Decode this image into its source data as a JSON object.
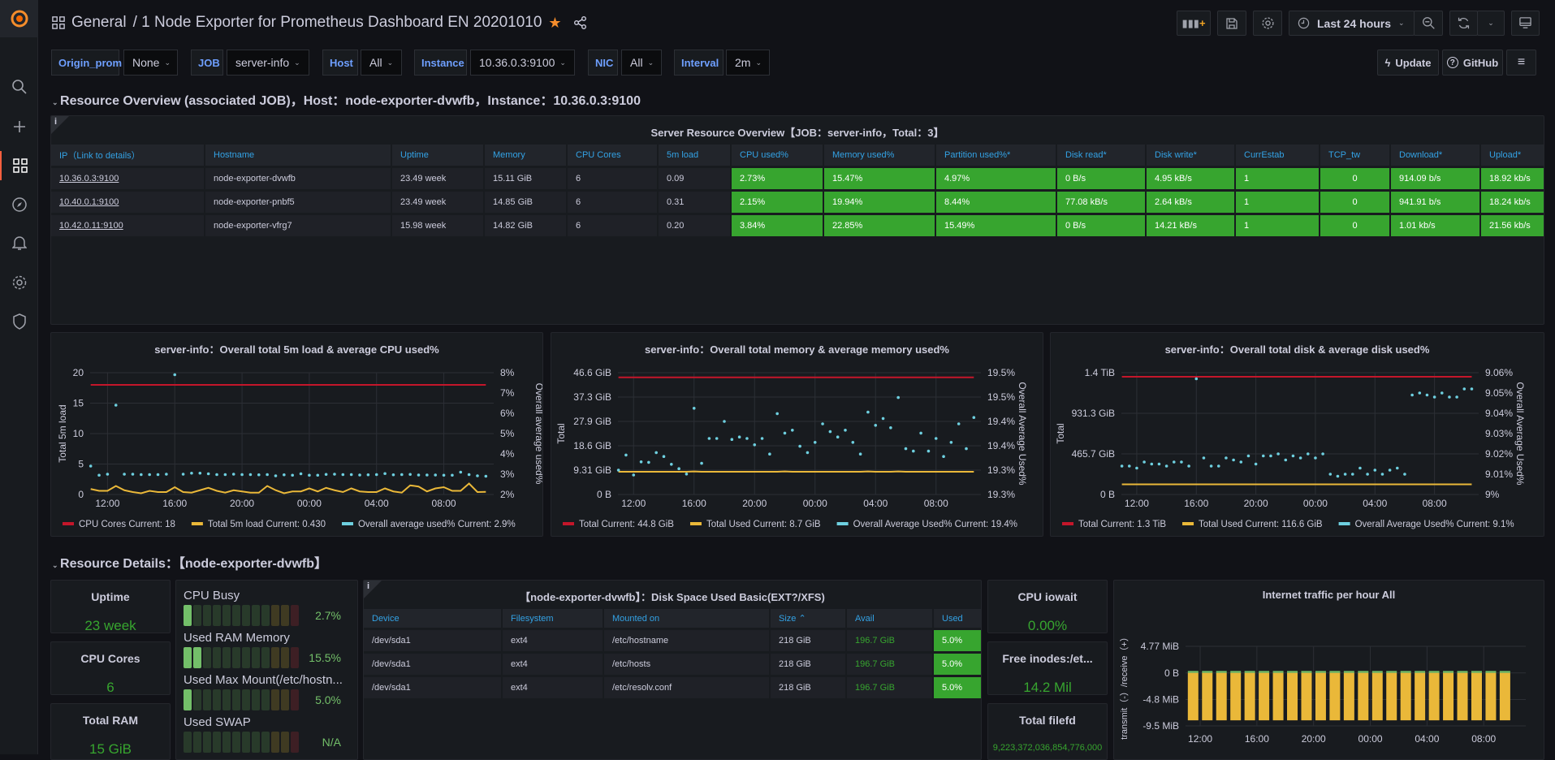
{
  "header": {
    "breadcrumb_folder": "General",
    "title": "/ 1 Node Exporter for Prometheus Dashboard EN 20201010",
    "time_range": "Last 24 hours",
    "update_label": "Update",
    "github_label": "GitHub"
  },
  "sidebar": {
    "items": [
      "grafana-logo",
      "search",
      "create",
      "dashboards",
      "explore",
      "alerting",
      "configuration",
      "server-admin"
    ]
  },
  "variables": [
    {
      "label": "Origin_prom",
      "value": "None"
    },
    {
      "label": "JOB",
      "value": "server-info"
    },
    {
      "label": "Host",
      "value": "All"
    },
    {
      "label": "Instance",
      "value": "10.36.0.3:9100"
    },
    {
      "label": "NIC",
      "value": "All"
    },
    {
      "label": "Interval",
      "value": "2m"
    }
  ],
  "rows": {
    "overview": "Resource Overview (associated JOB)，Host：node-exporter-dvwfb，Instance：10.36.0.3:9100",
    "details": "Resource Details：【node-exporter-dvwfb】"
  },
  "server_table": {
    "title": "Server Resource Overview【JOB：server-info，Total：3】",
    "columns": [
      "IP（Link to details）",
      "Hostname",
      "Uptime",
      "Memory",
      "CPU Cores",
      "5m load",
      "CPU used%",
      "Memory used%",
      "Partition used%*",
      "Disk read*",
      "Disk write*",
      "CurrEstab",
      "TCP_tw",
      "Download*",
      "Upload*"
    ],
    "rows": [
      [
        "10.36.0.3:9100",
        "node-exporter-dvwfb",
        "23.49 week",
        "15.11 GiB",
        "6",
        "0.09",
        "2.73%",
        "15.47%",
        "4.97%",
        "0 B/s",
        "4.95 kB/s",
        "1",
        "0",
        "914.09 b/s",
        "18.92 kb/s"
      ],
      [
        "10.40.0.1:9100",
        "node-exporter-pnbf5",
        "23.49 week",
        "14.85 GiB",
        "6",
        "0.31",
        "2.15%",
        "19.94%",
        "8.44%",
        "77.08 kB/s",
        "2.64 kB/s",
        "1",
        "0",
        "941.91 b/s",
        "18.24 kb/s"
      ],
      [
        "10.42.0.11:9100",
        "node-exporter-vfrg7",
        "15.98 week",
        "14.82 GiB",
        "6",
        "0.20",
        "3.84%",
        "22.85%",
        "15.49%",
        "0 B/s",
        "14.21 kB/s",
        "1",
        "0",
        "1.01 kb/s",
        "21.56 kb/s"
      ]
    ]
  },
  "colors": {
    "red": "#C4162A",
    "yellow": "#EAB839",
    "cyan": "#6ED0E0",
    "green": "#37A52F",
    "green_bar": "#73BF69"
  },
  "chart_data": [
    {
      "type": "line",
      "title": "server-info：Overall total 5m load & average CPU used%",
      "ylabel": "Total 5m load",
      "ylabel_right": "Overall average used%",
      "ylim": [
        0,
        20
      ],
      "yticks": [
        "0",
        "5",
        "10",
        "15",
        "20"
      ],
      "ylim_right": [
        2,
        8
      ],
      "yticks_right": [
        "2%",
        "3%",
        "4%",
        "5%",
        "6%",
        "7%",
        "8%"
      ],
      "xticks": [
        "12:00",
        "16:00",
        "20:00",
        "00:00",
        "04:00",
        "08:00"
      ],
      "x_start": "11:00",
      "x_step_minutes": 30,
      "grid": true,
      "legend": "bottom",
      "series": [
        {
          "name": "CPU Cores",
          "current": "Current: 18",
          "axis": "left",
          "style": "line",
          "color": "#C4162A",
          "values": [
            18,
            18,
            18,
            18,
            18,
            18,
            18,
            18,
            18,
            18,
            18,
            18,
            18,
            18,
            18,
            18,
            18,
            18,
            18,
            18,
            18,
            18,
            18,
            18,
            18,
            18,
            18,
            18,
            18,
            18,
            18,
            18,
            18,
            18,
            18,
            18,
            18,
            18,
            18,
            18,
            18,
            18,
            18,
            18,
            18,
            18,
            18,
            18
          ]
        },
        {
          "name": "Total 5m load",
          "current": "Current: 0.430",
          "axis": "left",
          "style": "line",
          "color": "#EAB839",
          "values": [
            0.9,
            0.6,
            0.6,
            1.4,
            0.7,
            0.4,
            0.2,
            0.6,
            0.4,
            0.4,
            1.2,
            0.4,
            0.3,
            0.7,
            1.1,
            0.6,
            0.3,
            0.7,
            0.5,
            0.3,
            0.3,
            1.4,
            0.7,
            0.2,
            0.5,
            0.5,
            1.0,
            0.5,
            1.1,
            0.7,
            0.4,
            1.0,
            0.5,
            0.4,
            0.4,
            1.0,
            0.5,
            0.3,
            1.5,
            1.3,
            0.5,
            1.0,
            1.2,
            0.6,
            0.6,
            1.8,
            0.4,
            0.43
          ]
        },
        {
          "name": "Overall average used%",
          "current": "Current: 2.9%",
          "axis": "right",
          "style": "points",
          "color": "#6ED0E0",
          "values": [
            3.4,
            2.95,
            3.0,
            6.4,
            3.0,
            3.0,
            2.98,
            2.98,
            2.98,
            3.0,
            7.9,
            3.0,
            3.05,
            3.05,
            3.02,
            2.98,
            2.98,
            3.0,
            2.98,
            2.98,
            2.97,
            2.98,
            2.92,
            2.97,
            2.95,
            3.02,
            2.95,
            2.95,
            2.99,
            3.0,
            2.98,
            2.98,
            2.96,
            2.97,
            2.98,
            3.03,
            2.97,
            2.98,
            2.99,
            2.96,
            2.96,
            2.96,
            2.95,
            2.95,
            3.1,
            2.98,
            2.92,
            2.9
          ]
        }
      ]
    },
    {
      "type": "line",
      "title": "server-info：Overall total memory & average memory used%",
      "ylabel": "Total",
      "ylabel_right": "Overall Average Used%",
      "ylim": [
        0,
        46.6
      ],
      "yticks": [
        "0 B",
        "9.31 GiB",
        "18.6 GiB",
        "27.9 GiB",
        "37.3 GiB",
        "46.6 GiB"
      ],
      "ylim_right": [
        19.275,
        19.525
      ],
      "yticks_right": [
        "19.3%",
        "19.3%",
        "19.4%",
        "19.4%",
        "19.5%",
        "19.5%"
      ],
      "xticks": [
        "12:00",
        "16:00",
        "20:00",
        "00:00",
        "04:00",
        "08:00"
      ],
      "x_start": "11:00",
      "x_step_minutes": 30,
      "grid": true,
      "legend": "bottom",
      "series": [
        {
          "name": "Total",
          "current": "Current: 44.8 GiB",
          "axis": "left",
          "style": "line",
          "color": "#C4162A",
          "values": [
            44.8,
            44.8,
            44.8,
            44.8,
            44.8,
            44.8,
            44.8,
            44.8,
            44.8,
            44.8,
            44.8,
            44.8,
            44.8,
            44.8,
            44.8,
            44.8,
            44.8,
            44.8,
            44.8,
            44.8,
            44.8,
            44.8,
            44.8,
            44.8,
            44.8,
            44.8,
            44.8,
            44.8,
            44.8,
            44.8,
            44.8,
            44.8,
            44.8,
            44.8,
            44.8,
            44.8,
            44.8,
            44.8,
            44.8,
            44.8,
            44.8,
            44.8,
            44.8,
            44.8,
            44.8,
            44.8,
            44.8,
            44.8
          ]
        },
        {
          "name": "Total Used",
          "current": "Current: 8.7 GiB",
          "axis": "left",
          "style": "line",
          "color": "#EAB839",
          "values": [
            8.7,
            8.7,
            8.7,
            8.7,
            8.7,
            8.7,
            8.7,
            8.7,
            8.7,
            8.7,
            8.8,
            8.7,
            8.7,
            8.7,
            8.7,
            8.7,
            8.7,
            8.7,
            8.7,
            8.7,
            8.7,
            8.7,
            8.8,
            8.7,
            8.7,
            8.7,
            8.7,
            8.7,
            8.7,
            8.7,
            8.7,
            8.7,
            8.7,
            8.8,
            8.7,
            8.7,
            8.7,
            8.8,
            8.7,
            8.7,
            8.7,
            8.7,
            8.7,
            8.7,
            8.7,
            8.7,
            8.7,
            8.7
          ]
        },
        {
          "name": "Overall Average Used%",
          "current": "Current: 19.4%",
          "axis": "right",
          "style": "points",
          "color": "#6ED0E0",
          "values": [
            19.325,
            19.356,
            19.315,
            19.342,
            19.341,
            19.361,
            19.353,
            19.337,
            19.328,
            19.317,
            19.452,
            19.339,
            19.39,
            19.39,
            19.425,
            19.388,
            19.393,
            19.39,
            19.377,
            19.39,
            19.358,
            19.441,
            19.401,
            19.407,
            19.374,
            19.361,
            19.382,
            19.42,
            19.404,
            19.393,
            19.407,
            19.382,
            19.358,
            19.444,
            19.417,
            19.431,
            19.412,
            19.474,
            19.369,
            19.364,
            19.401,
            19.364,
            19.39,
            19.353,
            19.382,
            19.42,
            19.369,
            19.433
          ]
        }
      ]
    },
    {
      "type": "line",
      "title": "server-info：Overall total disk & average disk used%",
      "ylabel": "Total",
      "ylabel_right": "Overall Average Used%",
      "ylim": [
        0,
        1397
      ],
      "yticks": [
        "0 B",
        "465.7 GiB",
        "931.3 GiB",
        "1.4 TiB"
      ],
      "ylim_right": [
        9.0,
        9.06
      ],
      "yticks_right": [
        "9%",
        "9.01%",
        "9.02%",
        "9.03%",
        "9.04%",
        "9.05%",
        "9.06%"
      ],
      "xticks": [
        "12:00",
        "16:00",
        "20:00",
        "00:00",
        "04:00",
        "08:00"
      ],
      "x_start": "11:00",
      "x_step_minutes": 30,
      "grid": true,
      "legend": "bottom",
      "series": [
        {
          "name": "Total",
          "current": "Current: 1.3 TiB",
          "axis": "left",
          "style": "line",
          "color": "#C4162A",
          "values": [
            1350,
            1350,
            1350,
            1350,
            1350,
            1350,
            1350,
            1350,
            1350,
            1350,
            1350,
            1350,
            1350,
            1350,
            1350,
            1350,
            1350,
            1350,
            1350,
            1350,
            1350,
            1350,
            1350,
            1350,
            1350,
            1350,
            1350,
            1350,
            1350,
            1350,
            1350,
            1350,
            1350,
            1350,
            1350,
            1350,
            1350,
            1350,
            1350,
            1350,
            1350,
            1350,
            1350,
            1350,
            1350,
            1350,
            1350,
            1350
          ]
        },
        {
          "name": "Total Used",
          "current": "Current: 116.6 GiB",
          "axis": "left",
          "style": "line",
          "color": "#EAB839",
          "values": [
            116.6,
            116.6,
            116.6,
            116.6,
            116.6,
            116.6,
            116.6,
            116.6,
            116.6,
            116.6,
            116.6,
            116.6,
            116.6,
            116.6,
            116.6,
            116.6,
            116.6,
            116.6,
            116.6,
            116.6,
            116.6,
            116.6,
            116.6,
            116.6,
            116.6,
            116.6,
            116.6,
            116.6,
            116.6,
            116.6,
            116.6,
            116.6,
            116.6,
            116.6,
            116.6,
            116.6,
            116.6,
            116.6,
            116.6,
            116.6,
            116.6,
            116.6,
            116.6,
            116.6,
            116.6,
            116.6,
            116.6,
            116.6
          ]
        },
        {
          "name": "Overall Average Used%",
          "current": "Current: 9.1%",
          "axis": "right",
          "style": "points",
          "color": "#6ED0E0",
          "values": [
            9.014,
            9.014,
            9.013,
            9.016,
            9.015,
            9.015,
            9.014,
            9.016,
            9.016,
            9.014,
            9.057,
            9.018,
            9.014,
            9.014,
            9.018,
            9.017,
            9.016,
            9.019,
            9.015,
            9.019,
            9.019,
            9.02,
            9.017,
            9.019,
            9.018,
            9.02,
            9.018,
            9.02,
            9.01,
            9.009,
            9.01,
            9.01,
            9.013,
            9.01,
            9.012,
            9.01,
            9.012,
            9.013,
            9.01,
            9.049,
            9.05,
            9.049,
            9.048,
            9.05,
            9.048,
            9.048,
            9.052,
            9.052
          ]
        }
      ]
    },
    {
      "type": "bar",
      "title": "Internet traffic per hour All",
      "ylabel": "transmit（-）/receive（+）",
      "ylim": [
        -9.5,
        4.77
      ],
      "yticks": [
        "-9.5 MiB",
        "-4.8 MiB",
        "0 B",
        "4.77 MiB"
      ],
      "ytick_values": [
        -9.5,
        -4.77,
        0,
        4.77
      ],
      "xticks": [
        "12:00",
        "16:00",
        "20:00",
        "00:00",
        "04:00",
        "08:00"
      ],
      "x_start": "11:00",
      "x_step_minutes": 60,
      "grid": true,
      "series": [
        {
          "name": "receive",
          "color": "#73BF69",
          "values": [
            0.35,
            0.35,
            0.35,
            0.35,
            0.35,
            0.35,
            0.35,
            0.35,
            0.35,
            0.35,
            0.35,
            0.35,
            0.35,
            0.35,
            0.35,
            0.35,
            0.35,
            0.35,
            0.35,
            0.35,
            0.35,
            0.35,
            0.35
          ]
        },
        {
          "name": "transmit",
          "color": "#EAB839",
          "values": [
            -8.5,
            -8.5,
            -8.5,
            -8.5,
            -8.5,
            -8.5,
            -8.5,
            -8.5,
            -8.5,
            -8.5,
            -8.5,
            -8.5,
            -8.5,
            -8.5,
            -8.5,
            -8.5,
            -8.5,
            -8.5,
            -8.5,
            -8.5,
            -8.5,
            -8.5,
            -8.5
          ]
        }
      ]
    }
  ],
  "stats": {
    "uptime": {
      "title": "Uptime",
      "value": "23 week"
    },
    "cpu_cores": {
      "title": "CPU Cores",
      "value": "6"
    },
    "total_ram": {
      "title": "Total RAM",
      "value": "15 GiB"
    },
    "iowait": {
      "title": "CPU iowait",
      "value": "0.00%"
    },
    "inodes": {
      "title": "Free inodes:/et...",
      "value": "14.2 Mil"
    },
    "filefd": {
      "title": "Total filefd",
      "value": "9,223,372,036,854,776,000"
    }
  },
  "bar_gauges": [
    {
      "label": "CPU Busy",
      "value": "2.7%",
      "percent": 2.7
    },
    {
      "label": "Used RAM Memory",
      "value": "15.5%",
      "percent": 15.5
    },
    {
      "label": "Used Max Mount(/etc/hostn...",
      "value": "5.0%",
      "percent": 5.0
    },
    {
      "label": "Used SWAP",
      "value": "N/A",
      "percent": null
    }
  ],
  "disk_table": {
    "title": "【node-exporter-dvwfb】：Disk Space Used Basic(EXT?/XFS)",
    "columns": [
      "Device",
      "Filesystem",
      "Mounted on",
      "Size ⌃",
      "Avail",
      "Used"
    ],
    "rows": [
      [
        "/dev/sda1",
        "ext4",
        "/etc/hostname",
        "218 GiB",
        "196.7 GiB",
        "5.0%"
      ],
      [
        "/dev/sda1",
        "ext4",
        "/etc/hosts",
        "218 GiB",
        "196.7 GiB",
        "5.0%"
      ],
      [
        "/dev/sda1",
        "ext4",
        "/etc/resolv.conf",
        "218 GiB",
        "196.7 GiB",
        "5.0%"
      ]
    ]
  }
}
